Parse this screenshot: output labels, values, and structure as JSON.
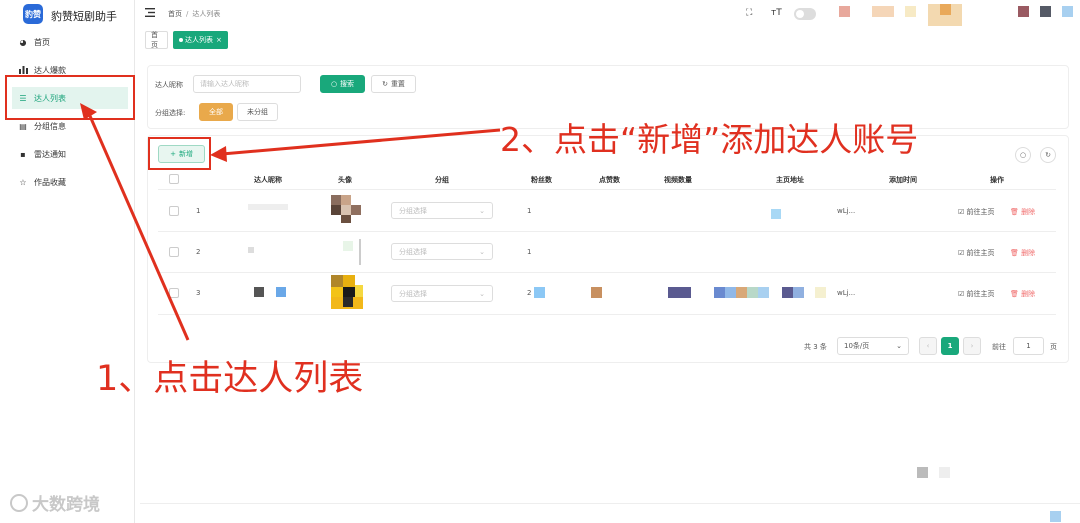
{
  "app": {
    "logo_text": "豹赞",
    "title": "豹赞短剧助手"
  },
  "sidebar": {
    "items": [
      {
        "label": "首页",
        "icon": "dashboard-icon"
      },
      {
        "label": "达人爆款",
        "icon": "bar-chart-icon"
      },
      {
        "label": "达人列表",
        "icon": "list-icon",
        "active": true
      },
      {
        "label": "分组信息",
        "icon": "group-icon"
      },
      {
        "label": "雷达通知",
        "icon": "message-icon"
      },
      {
        "label": "作品收藏",
        "icon": "star-icon"
      }
    ]
  },
  "header": {
    "breadcrumb": [
      "首页",
      "达人列表"
    ],
    "fullscreen_icon": "⛶",
    "font_size_icon": "тT"
  },
  "tags": [
    {
      "label": "首页"
    },
    {
      "label": "达人列表",
      "active": true,
      "close": "×"
    }
  ],
  "filter": {
    "name_label": "达人昵称",
    "name_placeholder": "请输入达人昵称",
    "search_label": "搜索",
    "reset_label": "重置",
    "group_label": "分组选择:",
    "group_options": [
      "全部",
      "未分组"
    ]
  },
  "toolbar": {
    "add_label": "新增"
  },
  "table": {
    "headers": [
      "达人昵称",
      "头像",
      "分组",
      "粉丝数",
      "点赞数",
      "视频数量",
      "主页地址",
      "添加时间",
      "操作"
    ],
    "select_placeholder": "分组选择",
    "rows": [
      {
        "index": "1",
        "fans": "1",
        "time": "wLj...",
        "go": "前往主页",
        "del": "删除"
      },
      {
        "index": "2",
        "fans": "1",
        "time": "",
        "go": "前往主页",
        "del": "删除"
      },
      {
        "index": "3",
        "fans": "2",
        "time": "wLj...",
        "go": "前往主页",
        "del": "删除"
      }
    ]
  },
  "pagination": {
    "total": "共 3 条",
    "page_size": "10条/页",
    "current": "1",
    "goto_label": "前往",
    "goto_value": "1",
    "page_unit": "页"
  },
  "annotations": {
    "step1": "1、点击达人列表",
    "step2": "2、点击“新增”添加达人账号",
    "color": "#e0301e"
  },
  "watermark": "大数跨境"
}
